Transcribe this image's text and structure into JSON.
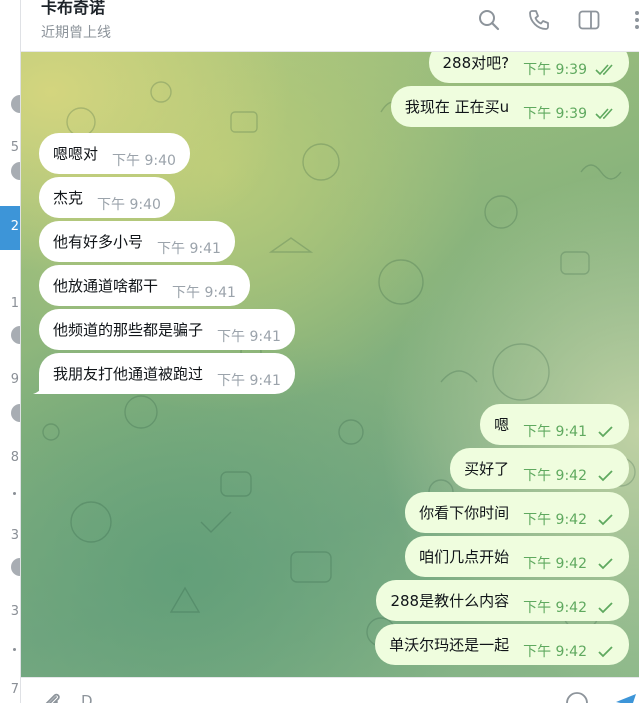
{
  "sidebar": {
    "counts": [
      "5",
      "2",
      "1",
      "9",
      "8",
      "3",
      "3",
      "7"
    ]
  },
  "header": {
    "title": "卡布奇诺",
    "status": "近期曾上线",
    "icons": [
      "search-icon",
      "phone-icon",
      "sidebar-toggle-icon",
      "more-icon"
    ]
  },
  "messages": [
    {
      "dir": "out",
      "text": "288对吧?",
      "time": "下午 9:39",
      "read": "double"
    },
    {
      "dir": "out",
      "text": "我现在 正在买u",
      "time": "下午 9:39",
      "read": "double"
    },
    {
      "dir": "in",
      "text": "嗯嗯对",
      "time": "下午 9:40"
    },
    {
      "dir": "in",
      "text": "杰克",
      "time": "下午 9:40"
    },
    {
      "dir": "in",
      "text": "他有好多小号",
      "time": "下午 9:41"
    },
    {
      "dir": "in",
      "text": "他放通道啥都干",
      "time": "下午 9:41"
    },
    {
      "dir": "in",
      "text": "他频道的那些都是骗子",
      "time": "下午 9:41"
    },
    {
      "dir": "in",
      "text": "我朋友打他通道被跑过",
      "time": "下午 9:41"
    },
    {
      "dir": "out",
      "text": "嗯",
      "time": "下午 9:41",
      "read": "single"
    },
    {
      "dir": "out",
      "text": "买好了",
      "time": "下午 9:42",
      "read": "single"
    },
    {
      "dir": "out",
      "text": "你看下你时间",
      "time": "下午 9:42",
      "read": "single"
    },
    {
      "dir": "out",
      "text": "咱们几点开始",
      "time": "下午 9:42",
      "read": "single"
    },
    {
      "dir": "out",
      "text": "288是教什么内容",
      "time": "下午 9:42",
      "read": "single"
    },
    {
      "dir": "out",
      "text": "单沃尔玛还是一起",
      "time": "下午 9:42",
      "read": "single"
    }
  ],
  "composer": {
    "value": "D",
    "icons": [
      "attach-icon",
      "emoji-icon",
      "send-icon"
    ]
  },
  "colors": {
    "accent": "#3d95d8",
    "outgoing_bubble": "#effdde",
    "outgoing_time": "#5fa95f",
    "incoming_bubble": "#ffffff"
  }
}
